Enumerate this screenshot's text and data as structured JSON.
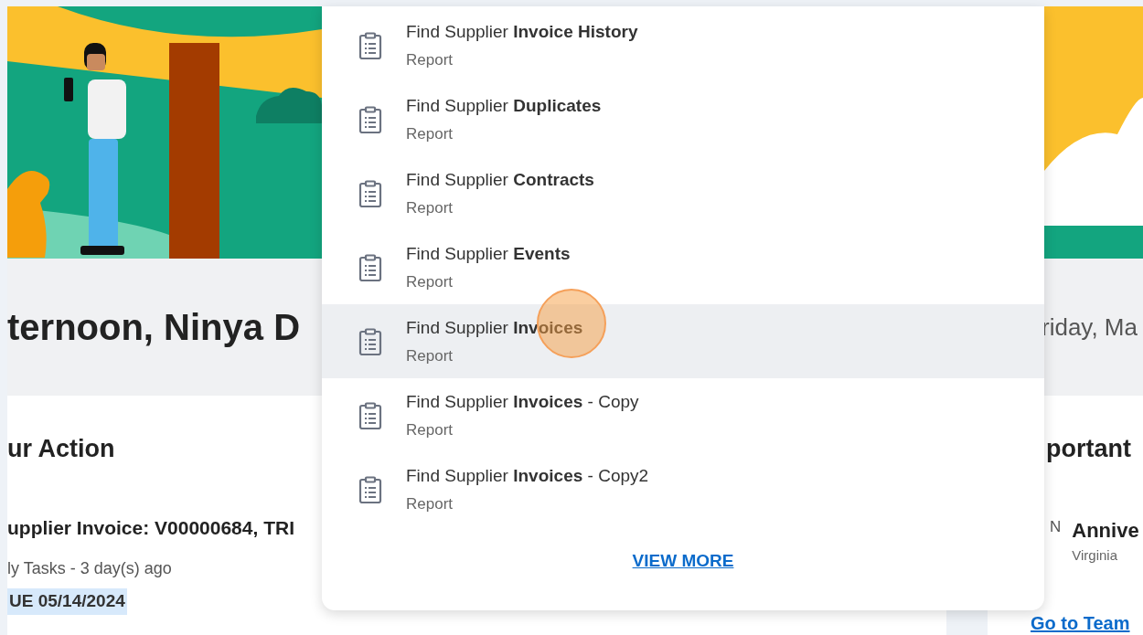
{
  "greeting": {
    "text": "ternoon, Ninya D",
    "date": "riday, Ma"
  },
  "action_card": {
    "heading": "ur Action",
    "item_title": "upplier Invoice: V00000684, TRI",
    "item_meta": "ly Tasks - 3 day(s) ago",
    "due_badge": "UE 05/14/2024"
  },
  "important_card": {
    "heading": "portant",
    "month": "N",
    "event_title": "Annive",
    "event_person": "Virginia",
    "link": "Go to Team"
  },
  "search_results": {
    "items": [
      {
        "title": "Find Supplier **Invoice History**",
        "type": "Report",
        "selected": false
      },
      {
        "title": "Find Supplier **Duplicates**",
        "type": "Report",
        "selected": false
      },
      {
        "title": "Find Supplier **Contracts**",
        "type": "Report",
        "selected": false
      },
      {
        "title": "Find Supplier **Events**",
        "type": "Report",
        "selected": false
      },
      {
        "title": "Find Supplier **Invoices**",
        "type": "Report",
        "selected": true
      },
      {
        "title": "Find Supplier **Invoices** - Copy",
        "type": "Report",
        "selected": false
      },
      {
        "title": "Find Supplier **Invoices** - Copy2",
        "type": "Report",
        "selected": false
      }
    ],
    "view_more": "VIEW MORE"
  }
}
